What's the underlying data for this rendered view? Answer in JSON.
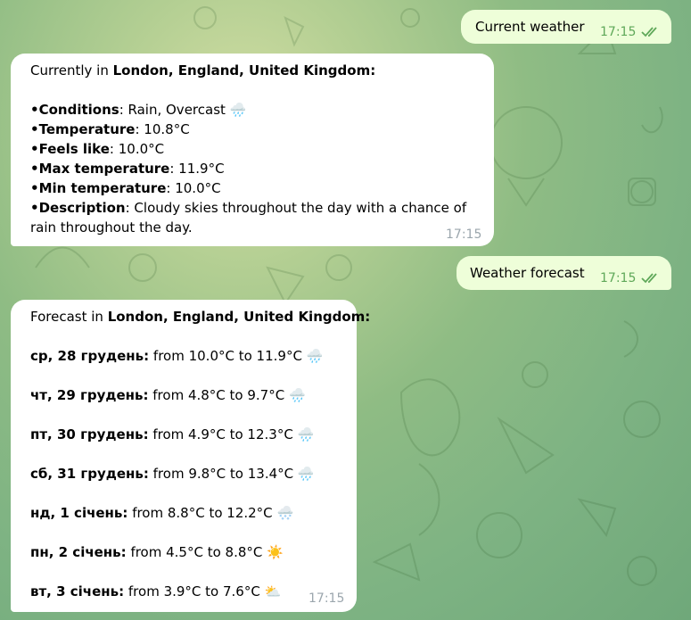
{
  "messages": {
    "current_weather_cmd": {
      "text": "Current weather",
      "time": "17:15"
    },
    "current_reply": {
      "intro": "Currently in ",
      "location": "London, England, United Kingdom:",
      "rows": [
        {
          "label": "•Conditions",
          "value": ": Rain, Overcast ",
          "icon": "🌧️"
        },
        {
          "label": "•Temperature",
          "value": ": 10.8°C"
        },
        {
          "label": "•Feels like",
          "value": ": 10.0°C"
        },
        {
          "label": "•Max temperature",
          "value": ": 11.9°C"
        },
        {
          "label": "•Min temperature",
          "value": ": 10.0°C"
        }
      ],
      "desc_label": "•Description",
      "desc_line1": ": Cloudy skies throughout the day with a chance of",
      "desc_line2": "rain throughout the day.",
      "time": "17:15"
    },
    "forecast_cmd": {
      "text": "Weather forecast",
      "time": "17:15"
    },
    "forecast_reply": {
      "intro": "Forecast in ",
      "location": "London, England, United Kingdom:",
      "days": [
        {
          "day": "ср, 28 грудень:",
          "range": " from 10.0°C to 11.9°C ",
          "icon": "🌧️"
        },
        {
          "day": "чт, 29 грудень:",
          "range": " from 4.8°C to 9.7°C ",
          "icon": "🌧️"
        },
        {
          "day": "пт, 30 грудень:",
          "range": " from 4.9°C to 12.3°C ",
          "icon": "🌧️"
        },
        {
          "day": "сб, 31 грудень:",
          "range": " from 9.8°C to 13.4°C ",
          "icon": "🌧️"
        },
        {
          "day": "нд, 1 січень:",
          "range": " from 8.8°C to 12.2°C ",
          "icon": "🌨️"
        },
        {
          "day": "пн, 2 січень:",
          "range": " from 4.5°C to 8.8°C ",
          "icon": "☀️"
        },
        {
          "day": "вт, 3 січень:",
          "range": " from 3.9°C to 7.6°C ",
          "icon": "⛅"
        }
      ],
      "time": "17:15"
    }
  },
  "icons": {
    "read_status": "double-check-icon"
  },
  "colors": {
    "outgoing_bubble": "#eefed9",
    "incoming_bubble": "#ffffff",
    "outgoing_time": "#5fa859"
  }
}
